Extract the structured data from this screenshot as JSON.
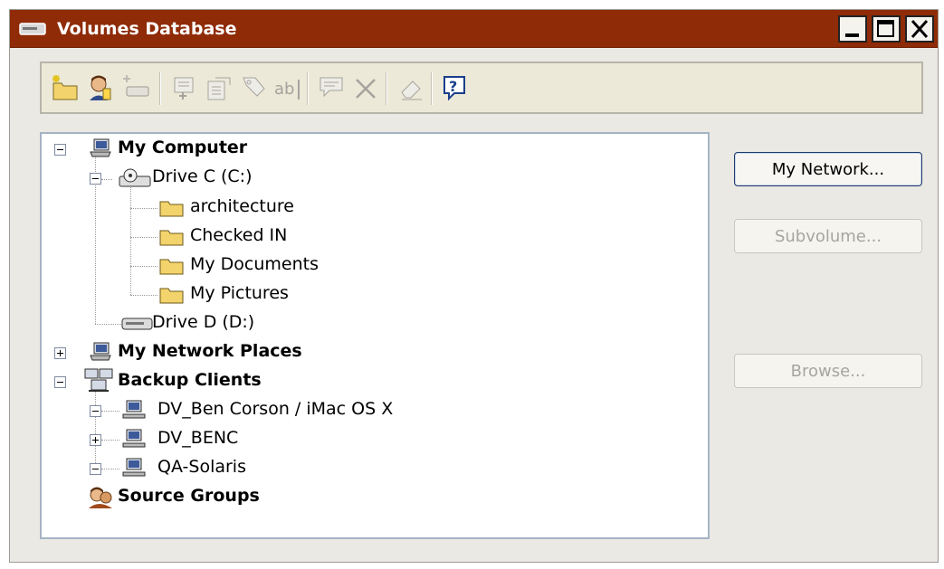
{
  "window": {
    "title": "Volumes Database",
    "buttons": [
      "minimize",
      "maximize",
      "close"
    ]
  },
  "toolbar": {
    "icons": [
      "new-folder-icon",
      "user-icon",
      "new-volume-icon",
      "properties-icon",
      "edit-icon",
      "link-icon",
      "rename-icon",
      "comment-icon",
      "delete-icon",
      "erase-icon",
      "help-icon"
    ]
  },
  "tree": {
    "my_computer": "My Computer",
    "drive_c": "Drive C (C:)",
    "folders": [
      "architecture",
      "Checked IN",
      "My Documents",
      "My Pictures"
    ],
    "drive_d": "Drive D (D:)",
    "network_places": "My Network Places",
    "backup_clients": "Backup Clients",
    "clients": [
      "DV_Ben Corson / iMac OS X",
      "DV_BENC",
      "QA-Solaris"
    ],
    "source_groups": "Source Groups"
  },
  "side_buttons": {
    "my_network": "My Network...",
    "subvolume": "Subvolume...",
    "browse": "Browse..."
  },
  "colors": {
    "titlebar": "#8f2b07",
    "window_bg": "#ebe9e3",
    "folder": "#f3d36b"
  }
}
